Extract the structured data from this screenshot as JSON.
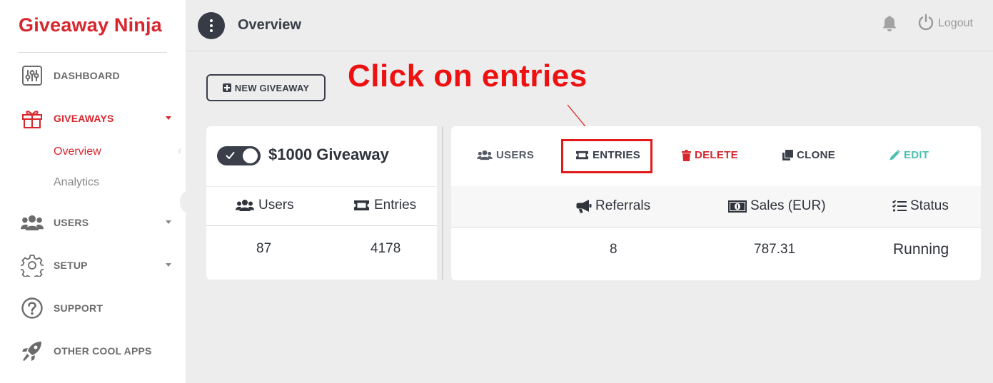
{
  "brand": {
    "name": "Giveaway Ninja"
  },
  "sidebar": {
    "items": [
      {
        "label": "DASHBOARD",
        "icon": "sliders-icon"
      },
      {
        "label": "GIVEAWAYS",
        "icon": "gift-icon",
        "active": true,
        "sub": [
          "Overview",
          "Analytics"
        ]
      },
      {
        "label": "USERS",
        "icon": "users-icon"
      },
      {
        "label": "SETUP",
        "icon": "gear-icon"
      },
      {
        "label": "SUPPORT",
        "icon": "question-icon"
      },
      {
        "label": "OTHER COOL APPS",
        "icon": "rocket-icon"
      }
    ]
  },
  "topbar": {
    "title": "Overview",
    "logout_label": "Logout"
  },
  "toolbar": {
    "new_giveaway_label": "NEW GIVEAWAY"
  },
  "annotation": {
    "text": "Click on entries"
  },
  "giveaway": {
    "name": "$1000 Giveaway",
    "enabled": true,
    "columns": {
      "users": "Users",
      "entries": "Entries"
    },
    "values": {
      "users": "87",
      "entries": "4178"
    }
  },
  "actions": {
    "users": "USERS",
    "entries": "ENTRIES",
    "delete": "DELETE",
    "clone": "CLONE",
    "edit": "EDIT"
  },
  "stats": {
    "columns": {
      "referrals": "Referrals",
      "sales": "Sales (EUR)",
      "status": "Status"
    },
    "values": {
      "referrals": "8",
      "sales": "787.31",
      "status": "Running"
    }
  },
  "colors": {
    "brand": "#d8262d",
    "dark": "#363b45",
    "delete": "#d8262d",
    "edit": "#4bbfb0",
    "annotation": "#ee1111"
  }
}
